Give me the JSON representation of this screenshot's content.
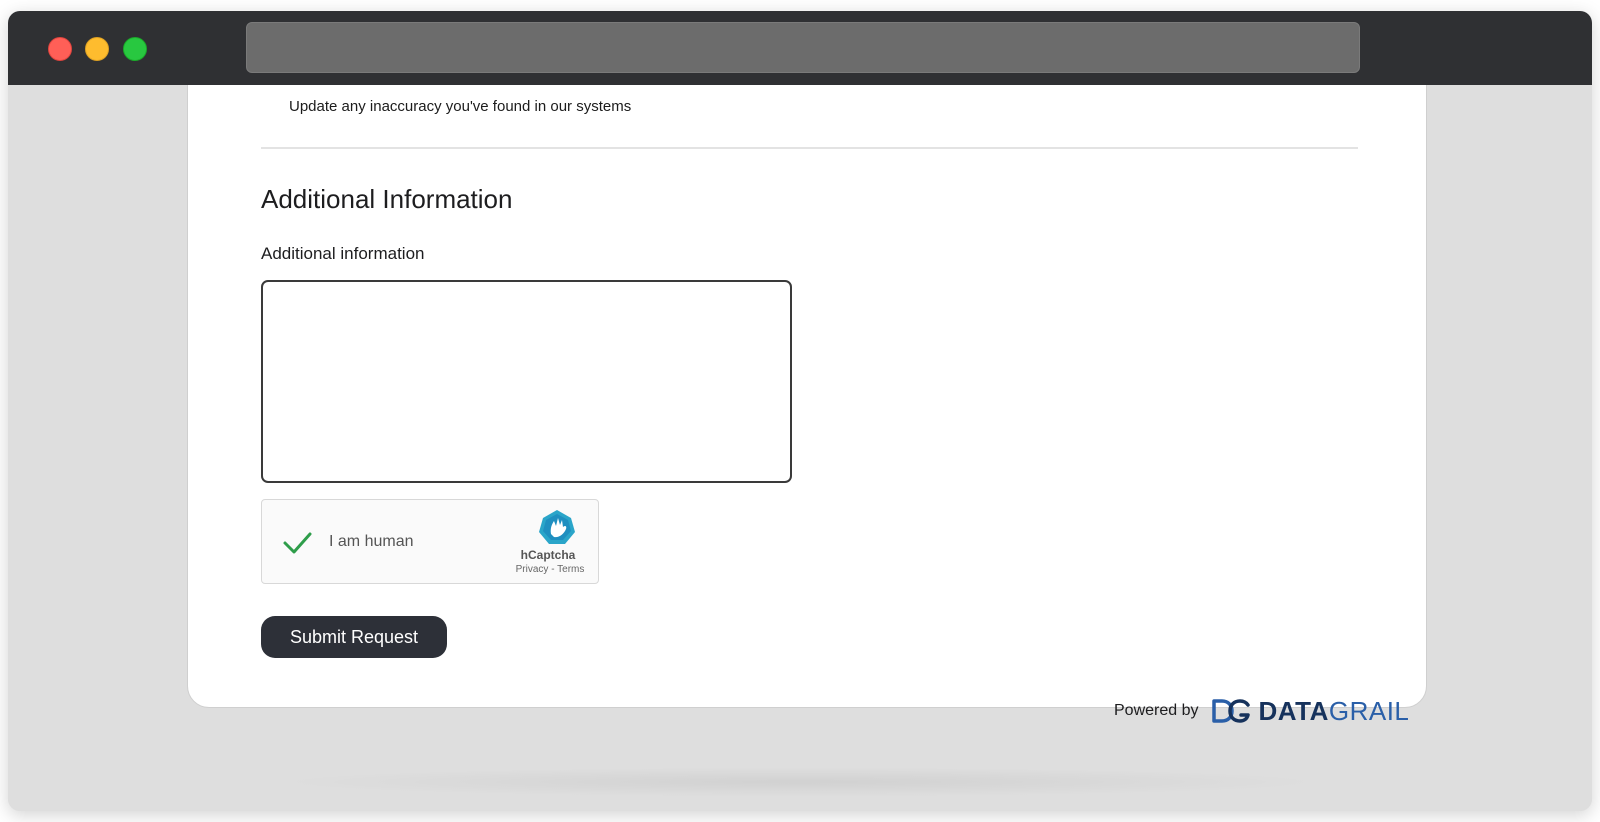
{
  "window": {
    "address_bar": ""
  },
  "request_option": {
    "description": "Update any inaccuracy you've found in our systems"
  },
  "additional_section": {
    "title": "Additional Information",
    "field_label": "Additional information",
    "field_value": "",
    "field_placeholder": ""
  },
  "captcha": {
    "label": "I am human",
    "checked": true,
    "provider": "hCaptcha",
    "privacy_link": "Privacy",
    "separator": " - ",
    "terms_link": "Terms",
    "check_color": "#2e9d4a"
  },
  "submit": {
    "label": "Submit Request",
    "color": "#2d3038"
  },
  "footer": {
    "powered_by": "Powered by",
    "brand_bold": "DATA",
    "brand_light": "GRAIL",
    "brand_color_dark": "#16325c",
    "brand_color_light": "#2a5fa8"
  },
  "icons": {
    "captcha_check": "checkmark-icon",
    "captcha_logo": "hcaptcha-logo-icon",
    "brand_logo": "datagrail-logo-icon"
  }
}
